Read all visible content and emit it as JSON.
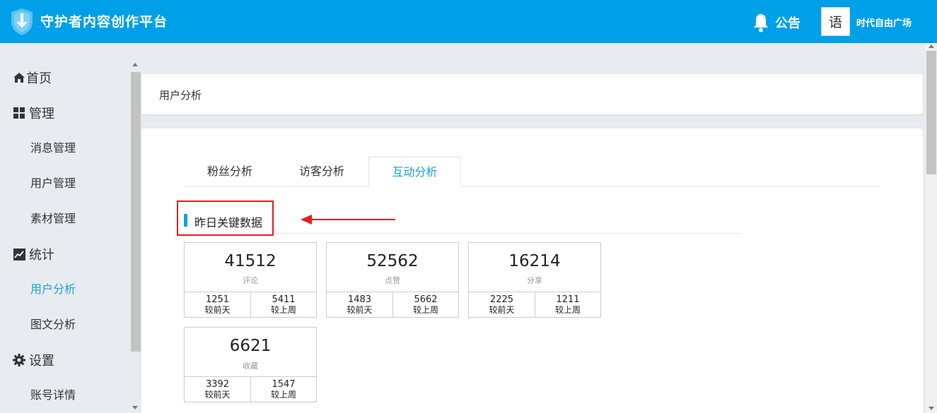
{
  "header": {
    "app_title": "守护者内容创作平台",
    "notice_label": "公告",
    "avatar_char": "语",
    "username": "时代自由广场",
    "bg_color": "#00a0e9"
  },
  "sidebar": {
    "home": "首页",
    "manage": "管理",
    "manage_items": [
      "消息管理",
      "用户管理",
      "素材管理"
    ],
    "stats": "统计",
    "stats_items": [
      "用户分析",
      "图文分析"
    ],
    "settings": "设置",
    "settings_items": [
      "账号详情"
    ],
    "active_item": "用户分析",
    "active_color": "#1a9fdc"
  },
  "breadcrumb": "用户分析",
  "tabs": [
    "粉丝分析",
    "访客分析",
    "互动分析"
  ],
  "active_tab": "互动分析",
  "section_title": "昨日关键数据",
  "stats": [
    {
      "value": "41512",
      "label": "评论",
      "left_value": "1251",
      "left_label": "较前天",
      "right_value": "5411",
      "right_label": "较上周"
    },
    {
      "value": "52562",
      "label": "点赞",
      "left_value": "1483",
      "left_label": "较前天",
      "right_value": "5662",
      "right_label": "较上周"
    },
    {
      "value": "16214",
      "label": "分享",
      "left_value": "2225",
      "left_label": "较前天",
      "right_value": "1211",
      "right_label": "较上周"
    },
    {
      "value": "6621",
      "label": "收藏",
      "left_value": "3392",
      "left_label": "较前天",
      "right_value": "1547",
      "right_label": "较上周"
    }
  ],
  "annotation_color": "#e21f1f"
}
